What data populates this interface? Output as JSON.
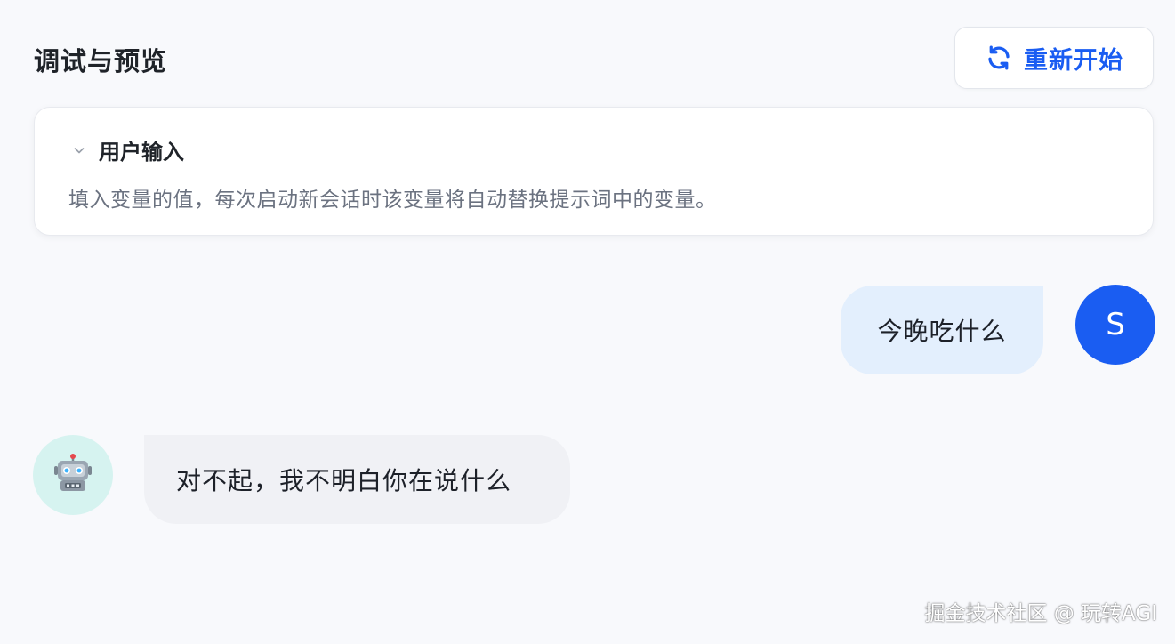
{
  "header": {
    "title": "调试与预览",
    "restart_label": "重新开始",
    "restart_icon": "refresh-icon"
  },
  "user_input_card": {
    "title": "用户输入",
    "collapse_icon": "chevron-down-icon",
    "description": "填入变量的值，每次启动新会话时该变量将自动替换提示词中的变量。"
  },
  "chat": {
    "messages": [
      {
        "role": "user",
        "avatar_letter": "S",
        "text": "今晚吃什么"
      },
      {
        "role": "bot",
        "avatar_icon": "robot-icon",
        "text": "对不起，我不明白你在说什么"
      }
    ]
  },
  "watermark": "掘金技术社区 @ 玩转AGI",
  "colors": {
    "accent": "#1a5df2",
    "user_bubble": "#e3effd",
    "bot_bubble": "#f0f1f5",
    "bot_avatar_bg": "#d6f3f0",
    "page_bg": "#f8f9fc"
  }
}
